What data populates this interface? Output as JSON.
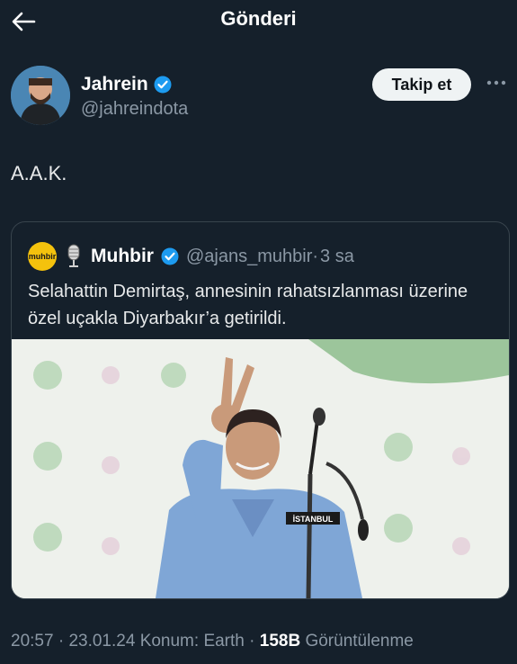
{
  "header": {
    "title": "Gönderi",
    "back_icon": "arrow-left-icon"
  },
  "author": {
    "name": "Jahrein",
    "handle": "@jahreindota",
    "verified": true,
    "follow_label": "Takip et"
  },
  "tweet": {
    "text": "A.A.K."
  },
  "quoted": {
    "avatar_text": "muhbir",
    "name": "Muhbir",
    "handle": "@ajans_muhbir",
    "separator": "·",
    "time": "3 sa",
    "text": "Selahattin Demirtaş, annesinin rahatsızlanması üzerine özel uçakla Diyarbakır’a getirildi.",
    "image_label": "İSTANBUL"
  },
  "meta": {
    "time": "20:57",
    "dot1": "·",
    "date": "23.01.24",
    "location": "Konum: Earth",
    "dot2": "·",
    "views_count": "158B",
    "views_label": "Görüntülenme"
  },
  "colors": {
    "background": "#15202b",
    "verified": "#1d9bf0",
    "muted": "#8b98a5"
  }
}
